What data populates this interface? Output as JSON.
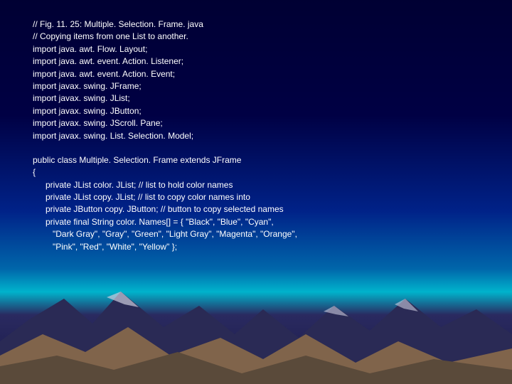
{
  "code": {
    "l1": "// Fig. 11. 25: Multiple. Selection. Frame. java",
    "l2": "// Copying items from one List to another.",
    "l3": "import java. awt. Flow. Layout;",
    "l4": "import java. awt. event. Action. Listener;",
    "l5": "import java. awt. event. Action. Event;",
    "l6": "import javax. swing. JFrame;",
    "l7": "import javax. swing. JList;",
    "l8": "import javax. swing. JButton;",
    "l9": "import javax. swing. JScroll. Pane;",
    "l10": "import javax. swing. List. Selection. Model;",
    "l11": "public class Multiple. Selection. Frame extends JFrame",
    "l12": "{",
    "l13": "private JList color. JList; // list to hold color names",
    "l14": "private JList copy. JList; // list to copy color names into",
    "l15": "private JButton copy. JButton; // button to copy selected names",
    "l16": "private final String color. Names[] = { \"Black\", \"Blue\", \"Cyan\",",
    "l17": "\"Dark Gray\", \"Gray\", \"Green\", \"Light Gray\", \"Magenta\", \"Orange\",",
    "l18": "\"Pink\", \"Red\", \"White\", \"Yellow\" };"
  }
}
